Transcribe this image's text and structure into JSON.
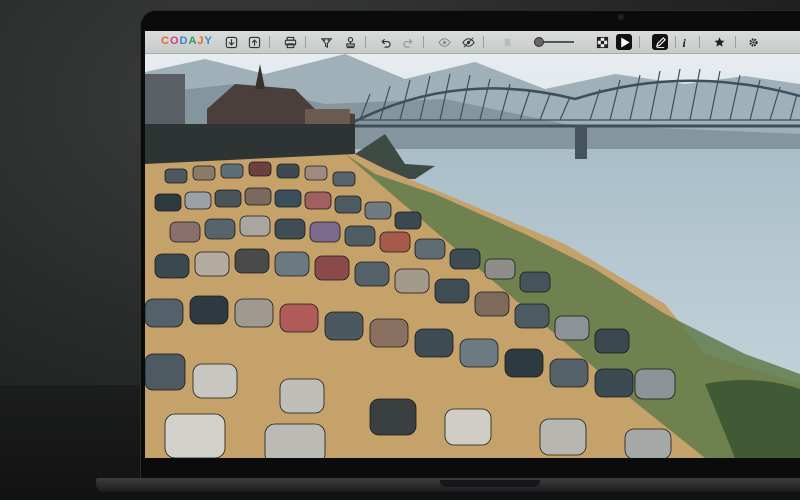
{
  "app": {
    "logo_text": "CODAJY",
    "logo_letters": [
      "C",
      "O",
      "D",
      "A",
      "J",
      "Y"
    ]
  },
  "toolbar": {
    "icons": [
      "download-icon",
      "upload-icon",
      "print-icon",
      "filter-icon",
      "stamp-icon",
      "undo-icon",
      "redo-icon",
      "eye-icon",
      "eye-slash-icon",
      "brightness-icon",
      "transparency-icon",
      "play-icon",
      "pen-icon",
      "info-icon",
      "star-icon",
      "settings-icon"
    ],
    "zoom_slider_level": 0.1
  },
  "image": {
    "description_none": ""
  },
  "colors": {
    "toolbar_bg": "#c6cac8",
    "active_button": "#111111",
    "screen_bezel": "#0b0b0c"
  }
}
